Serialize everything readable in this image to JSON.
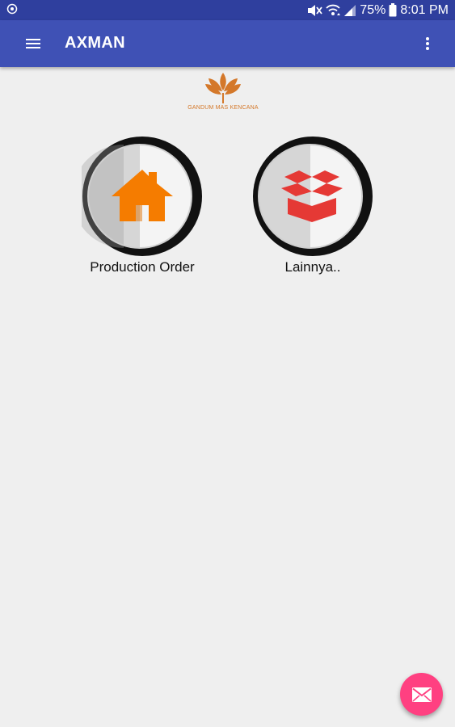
{
  "status_bar": {
    "battery": "75%",
    "time": "8:01 PM",
    "icons": [
      "notification-icon",
      "mute-icon",
      "wifi-icon",
      "signal-icon",
      "battery-icon"
    ]
  },
  "app_bar": {
    "title": "AXMAN",
    "icons": [
      "menu-icon",
      "more-vert-icon"
    ]
  },
  "logo": {
    "text": "GANDUM MAS KENCANA",
    "color": "#d4782a"
  },
  "tiles": [
    {
      "label": "Production Order",
      "icon": "house-icon",
      "color": "#f57c00"
    },
    {
      "label": "Lainnya..",
      "icon": "box-icon",
      "color": "#e53935"
    }
  ],
  "fab": {
    "icon": "mail-icon",
    "color": "#ff4081"
  },
  "colors": {
    "primary": "#3f51b5",
    "primary_dark": "#2f3f9e",
    "background": "#efefef"
  }
}
